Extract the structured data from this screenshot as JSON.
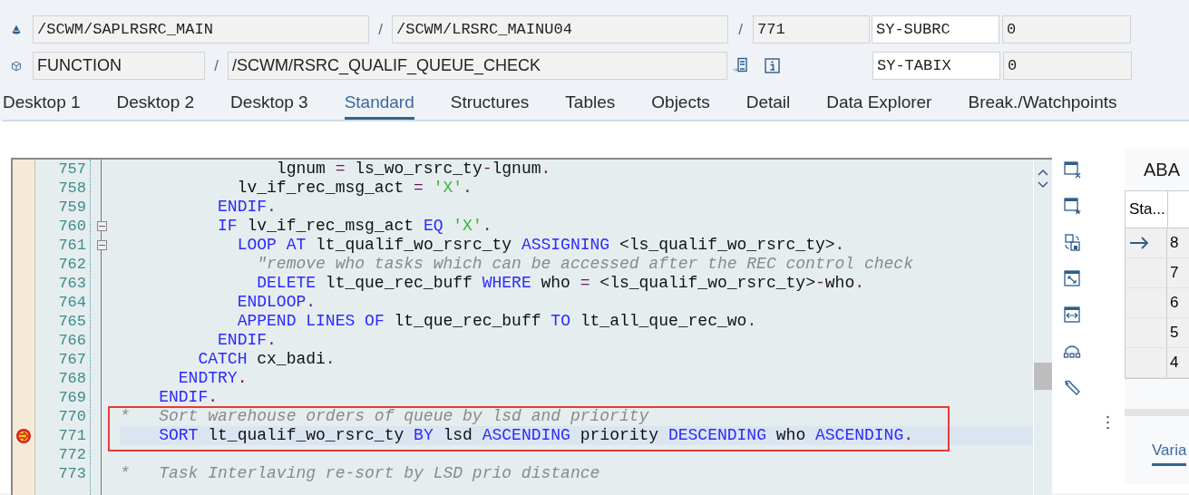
{
  "header_rows": [
    {
      "items": [
        {
          "kind": "field",
          "value": "/SCWM/SAPLRSRC_MAIN"
        },
        {
          "kind": "separator",
          "text": "/"
        },
        {
          "kind": "field",
          "value": "/SCWM/LRSRC_MAINU04"
        },
        {
          "kind": "separator",
          "text": "/"
        },
        {
          "kind": "field",
          "value": "771"
        },
        {
          "kind": "name",
          "value": "SY-SUBRC"
        },
        {
          "kind": "value",
          "value": "0"
        }
      ]
    },
    {
      "items": [
        {
          "kind": "field",
          "value": "FUNCTION"
        },
        {
          "kind": "separator",
          "text": "/"
        },
        {
          "kind": "field",
          "value": "/SCWM/RSRC_QUALIF_QUEUE_CHECK"
        },
        {
          "kind": "jump"
        },
        {
          "kind": "info"
        },
        {
          "kind": "name",
          "value": "SY-TABIX"
        },
        {
          "kind": "value",
          "value": "0"
        }
      ]
    }
  ],
  "tabs": [
    {
      "label": "Desktop 1",
      "selected": false
    },
    {
      "label": "Desktop 2",
      "selected": false
    },
    {
      "label": "Desktop 3",
      "selected": false
    },
    {
      "label": "Standard",
      "selected": true
    },
    {
      "label": "Structures",
      "selected": false
    },
    {
      "label": "Tables",
      "selected": false
    },
    {
      "label": "Objects",
      "selected": false
    },
    {
      "label": "Detail",
      "selected": false
    },
    {
      "label": "Data Explorer",
      "selected": false
    },
    {
      "label": "Break./Watchpoints",
      "selected": false
    }
  ],
  "editor": {
    "lines": [
      {
        "number": "757",
        "fold": false,
        "current": false,
        "framed": false,
        "text": "                lgnum = ls_wo_rsrc_ty-lgnum."
      },
      {
        "number": "758",
        "fold": false,
        "current": false,
        "framed": false,
        "text": "            lv_if_rec_msg_act = 'X'."
      },
      {
        "number": "759",
        "fold": false,
        "current": false,
        "framed": false,
        "text": "          ENDIF."
      },
      {
        "number": "760",
        "fold": true,
        "current": false,
        "framed": false,
        "text": "          IF lv_if_rec_msg_act EQ 'X'."
      },
      {
        "number": "761",
        "fold": true,
        "current": false,
        "framed": false,
        "text": "            LOOP AT lt_qualif_wo_rsrc_ty ASSIGNING <ls_qualif_wo_rsrc_ty>."
      },
      {
        "number": "762",
        "fold": false,
        "current": false,
        "framed": false,
        "text": "              \"remove who tasks which can be accessed after the REC control check"
      },
      {
        "number": "763",
        "fold": false,
        "current": false,
        "framed": false,
        "text": "              DELETE lt_que_rec_buff WHERE who = <ls_qualif_wo_rsrc_ty>-who."
      },
      {
        "number": "764",
        "fold": false,
        "current": false,
        "framed": false,
        "text": "            ENDLOOP."
      },
      {
        "number": "765",
        "fold": false,
        "current": false,
        "framed": false,
        "text": "            APPEND LINES OF lt_que_rec_buff TO lt_all_que_rec_wo."
      },
      {
        "number": "766",
        "fold": false,
        "current": false,
        "framed": false,
        "text": "          ENDIF."
      },
      {
        "number": "767",
        "fold": false,
        "current": false,
        "framed": false,
        "text": "        CATCH cx_badi."
      },
      {
        "number": "768",
        "fold": false,
        "current": false,
        "framed": false,
        "text": "      ENDTRY."
      },
      {
        "number": "769",
        "fold": false,
        "current": false,
        "framed": false,
        "text": "    ENDIF."
      },
      {
        "number": "770",
        "fold": false,
        "current": false,
        "framed": true,
        "text": "*   Sort warehouse orders of queue by lsd and priority"
      },
      {
        "number": "771",
        "fold": false,
        "current": true,
        "framed": true,
        "text": "    SORT lt_qualif_wo_rsrc_ty BY lsd ASCENDING priority DESCENDING who ASCENDING."
      },
      {
        "number": "772",
        "fold": false,
        "current": false,
        "framed": false
      },
      {
        "number": "773",
        "fold": false,
        "current": false,
        "framed": false,
        "text": "*   Task Interlaving re-sort by LSD prio distance"
      }
    ]
  },
  "right_panel": {
    "title": "ABA",
    "table": {
      "columns": [
        "Sta..."
      ],
      "rows": [
        {
          "current": true,
          "column_2": "8"
        },
        {
          "current": false,
          "column_2": "7"
        },
        {
          "current": false,
          "column_2": "6"
        },
        {
          "current": false,
          "column_2": "5"
        },
        {
          "current": false,
          "column_2": "4"
        }
      ]
    },
    "tabs": [
      {
        "label": "Varia",
        "selected": true
      }
    ]
  }
}
